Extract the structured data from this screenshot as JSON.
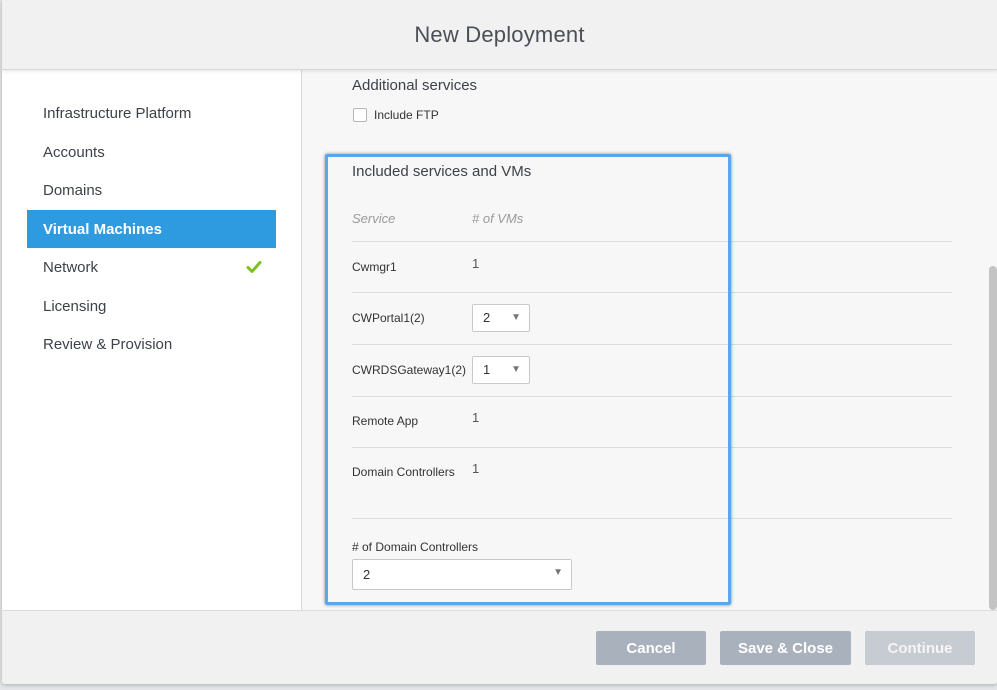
{
  "dialog": {
    "title": "New Deployment"
  },
  "sidebar": {
    "items": [
      {
        "label": "Infrastructure Platform",
        "active": false,
        "completed": false
      },
      {
        "label": "Accounts",
        "active": false,
        "completed": false
      },
      {
        "label": "Domains",
        "active": false,
        "completed": false
      },
      {
        "label": "Virtual Machines",
        "active": true,
        "completed": false
      },
      {
        "label": "Network",
        "active": false,
        "completed": true
      },
      {
        "label": "Licensing",
        "active": false,
        "completed": false
      },
      {
        "label": "Review & Provision",
        "active": false,
        "completed": false
      }
    ],
    "active_color": "#2e9ae0",
    "check_icon": "check-icon",
    "check_color": "#7cc11f"
  },
  "additional_services": {
    "title": "Additional services",
    "include_ftp": {
      "label": "Include FTP",
      "checked": false
    }
  },
  "included_services": {
    "title": "Included services and VMs",
    "columns": [
      "Service",
      "# of VMs"
    ],
    "rows": [
      {
        "service": "Cwmgr1",
        "vms": "1",
        "editable": false
      },
      {
        "service": "CWPortal1(2)",
        "vms": "2",
        "editable": true
      },
      {
        "service": "CWRDSGateway1(2)",
        "vms": "1",
        "editable": true
      },
      {
        "service": "Remote App",
        "vms": "1",
        "editable": false
      },
      {
        "service": "Domain Controllers",
        "vms": "1",
        "editable": false
      }
    ],
    "domain_controllers_label": "# of Domain Controllers",
    "domain_controllers_value": "2",
    "highlight_color": "#5aa7ee"
  },
  "footer": {
    "cancel_label": "Cancel",
    "save_label": "Save & Close",
    "continue_label": "Continue"
  }
}
